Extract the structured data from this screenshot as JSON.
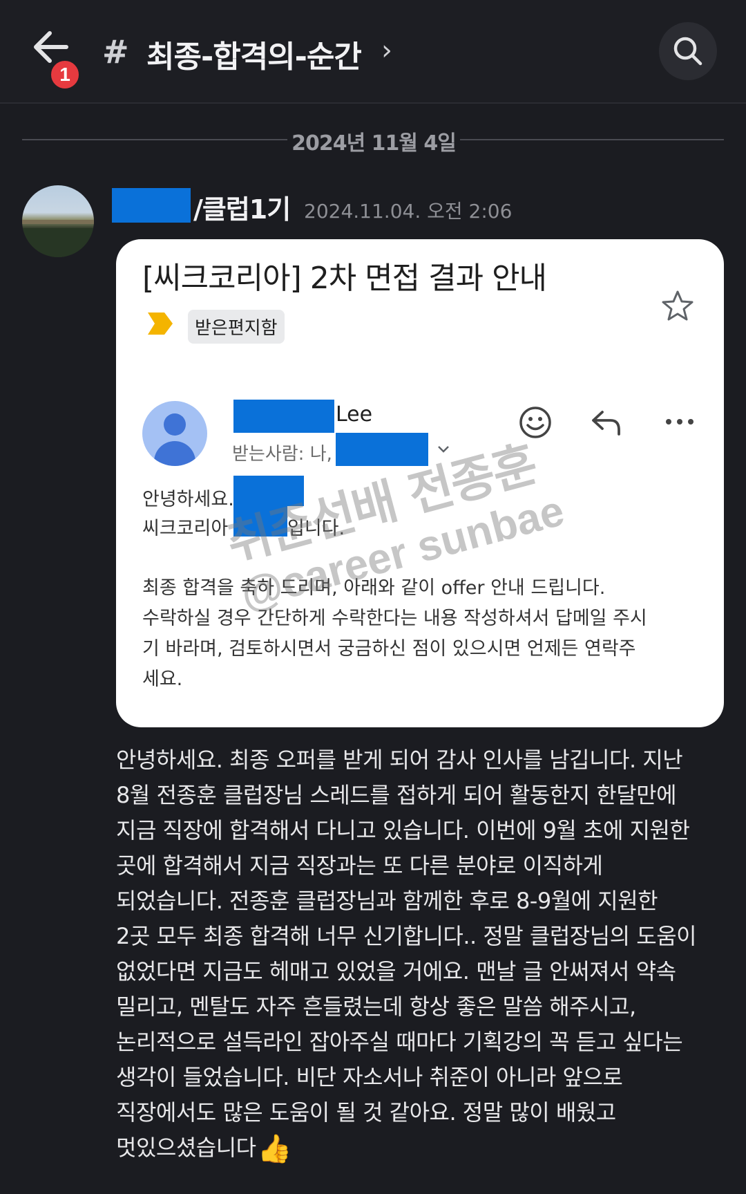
{
  "header": {
    "back_badge": "1",
    "channel_hash": "#",
    "channel_name": "최종-합격의-순간",
    "chevron": "›",
    "icons": {
      "back": "arrow-left-icon",
      "search": "search-icon"
    }
  },
  "date_divider": "2024년 11월 4일",
  "message": {
    "author_suffix": "/클럽1기",
    "timestamp": "2024.11.04. 오전 2:06",
    "redaction_color": "#0a71d9",
    "email": {
      "subject": "[씨크코리아] 2차 면접 결과 안내",
      "folder": "받은편지함",
      "sender_name_suffix": "Lee",
      "recipients_prefix": "받는사람: 나,",
      "body": {
        "greeting": "안녕하세요.",
        "company_prefix": "씨크코리아",
        "company_suffix": "입니다.",
        "line1": "최종 합격을 축하 드리며, 아래와 같이 offer 안내 드립니다.",
        "line2": "수락하실 경우 간단하게 수락한다는 내용 작성하셔서 답메일 주시",
        "line3": "기 바라며, 검토하시면서 궁금하신 점이 있으시면 언제든 연락주",
        "line4": "세요."
      },
      "watermark": {
        "korean": "취준선배 전종훈",
        "english": "@career sunbae"
      },
      "icons": [
        "star-icon",
        "label-arrow-icon",
        "emoji-icon",
        "reply-icon",
        "more-icon"
      ]
    },
    "text_lines": [
      "안녕하세요. 최종 오퍼를 받게 되어 감사 인사를 남깁니다. 지난",
      "8월 전종훈 클럽장님 스레드를 접하게 되어 활동한지 한달만에",
      "지금 직장에 합격해서 다니고 있습니다. 이번에 9월 초에 지원한",
      "곳에 합격해서 지금 직장과는 또 다른 분야로 이직하게",
      "되었습니다. 전종훈 클럽장님과 함께한 후로 8-9월에 지원한",
      "2곳 모두 최종 합격해 너무 신기합니다.. 정말 클럽장님의 도움이",
      "없었다면 지금도 헤매고 있었을 거에요. 맨날 글 안써져서 약속",
      "밀리고, 멘탈도 자주 흔들렸는데 항상 좋은 말씀 해주시고,",
      "논리적으로 설득라인 잡아주실 때마다 기획강의 꼭 듣고 싶다는",
      "생각이 들었습니다. 비단 자소서나 취준이 아니라 앞으로",
      "직장에서도 많은 도움이 될 것 같아요. 정말 많이 배웠고"
    ],
    "last_line": "멋있으셨습니다",
    "last_emoji": "👍"
  }
}
